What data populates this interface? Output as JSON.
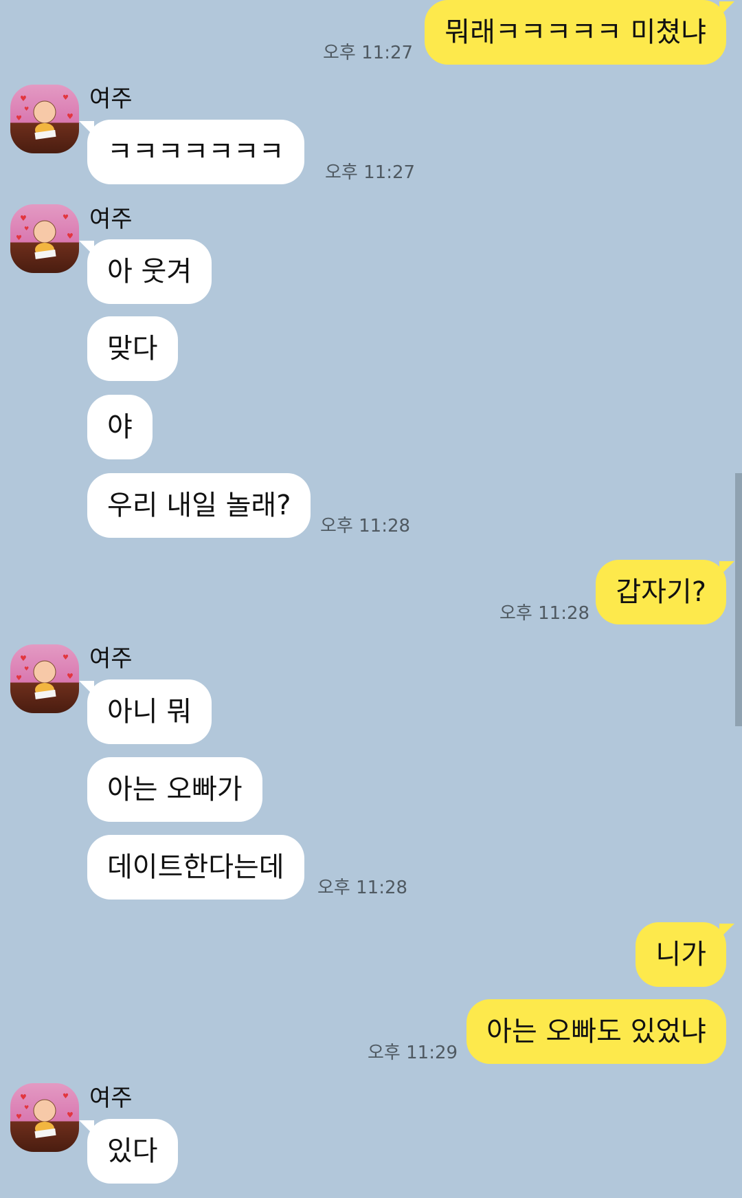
{
  "contact": {
    "name": "여주",
    "avatar_icon": "baby-drawing-avatar-icon"
  },
  "colors": {
    "background": "#b2c7da",
    "incoming_bubble": "#ffffff",
    "outgoing_bubble": "#fde94c"
  },
  "messages": [
    {
      "text": "뭐래ㅋㅋㅋㅋㅋ 미쳤냐",
      "time": "오후 11:27"
    },
    {
      "text": "ㅋㅋㅋㅋㅋㅋㅋ",
      "time": "오후 11:27"
    },
    {
      "text": "아 웃겨"
    },
    {
      "text": "맞다"
    },
    {
      "text": "야"
    },
    {
      "text": "우리 내일 놀래?",
      "time": "오후 11:28"
    },
    {
      "text": "갑자기?",
      "time": "오후 11:28"
    },
    {
      "text": "아니 뭐"
    },
    {
      "text": "아는 오빠가"
    },
    {
      "text": "데이트한다는데",
      "time": "오후 11:28"
    },
    {
      "text": "니가"
    },
    {
      "text": "아는 오빠도 있었냐",
      "time": "오후 11:29"
    },
    {
      "text": "있다"
    }
  ]
}
